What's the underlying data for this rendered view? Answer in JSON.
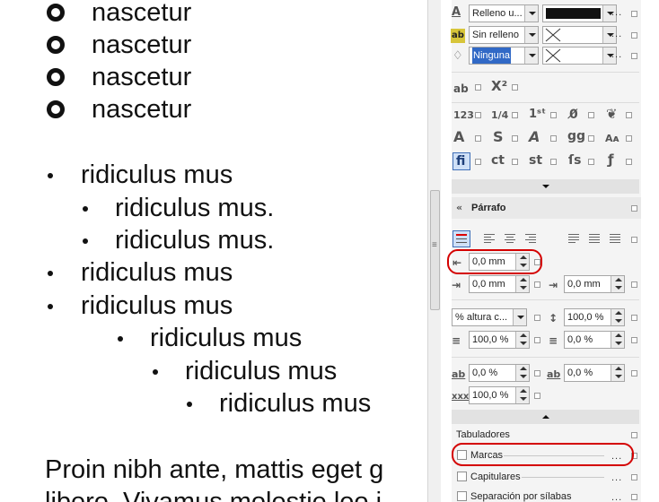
{
  "document": {
    "ordered_items": [
      "nascetur",
      "nascetur",
      "nascetur",
      "nascetur"
    ],
    "bullets": [
      "ridiculus mus",
      "ridiculus mus.",
      "ridiculus mus.",
      "ridiculus mus",
      "ridiculus mus",
      "ridiculus mus",
      "ridiculus mus",
      "ridiculus mus"
    ],
    "paragraph_line1": "Proin nibh ante, mattis eget g",
    "paragraph_line2": "libero. Vivamus molestie leo i"
  },
  "character": {
    "fill_label": "Relleno u...",
    "background_label": "Sin relleno",
    "outline_label": "Ninguna",
    "fill_color": "#111111",
    "more": "..."
  },
  "paragraph": {
    "title": "Párrafo",
    "first_indent": "0,0 mm",
    "left_indent": "0,0 mm",
    "right_indent": "0,0 mm",
    "line_spacing_unit": "% altura c...",
    "line_spacing": "100,0 %",
    "before_paragraph": "100,0 %",
    "after_paragraph": "0,0 %",
    "char_spacing": "0,0 %",
    "word_spacing": "0,0 %",
    "lang_spacing": "100,0 %"
  },
  "sections": {
    "tabs": "Tabuladores",
    "bullets": "Marcas",
    "dropcaps": "Capitulares",
    "hyphenation": "Separación por sílabas",
    "more": "..."
  },
  "colors": {
    "highlight": "#d40000",
    "selection": "#3169c6"
  }
}
